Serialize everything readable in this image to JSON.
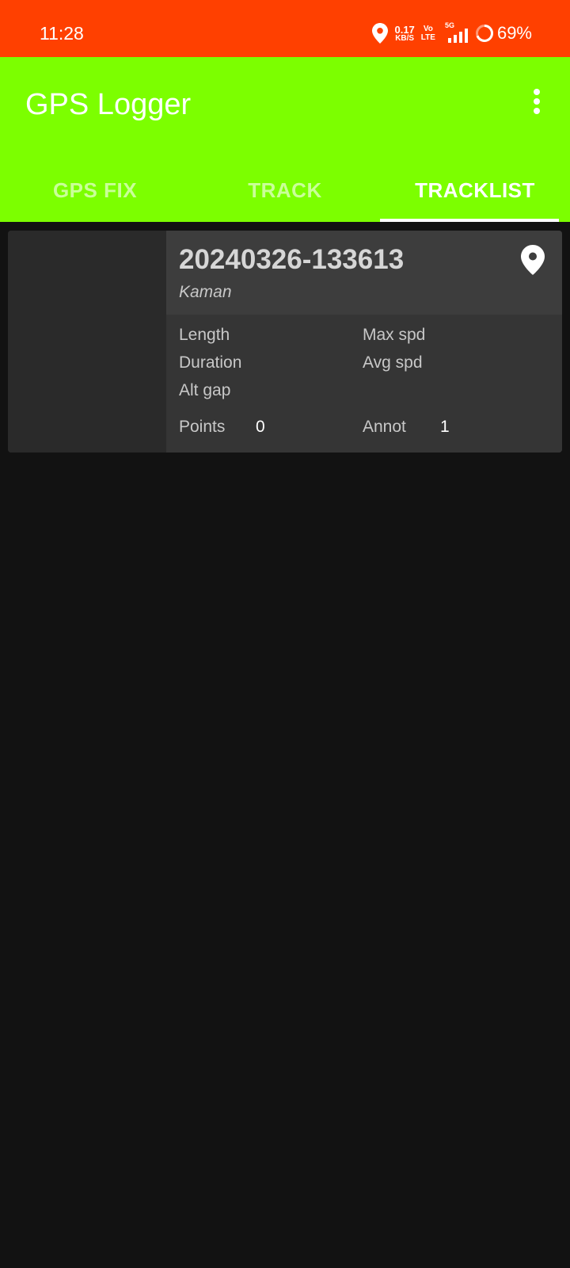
{
  "status_bar": {
    "time": "11:28",
    "net_speed_value": "0.17",
    "net_speed_unit": "KB/S",
    "volte_top": "Vo",
    "volte_bottom": "LTE",
    "network_type": "5G",
    "battery": "69%",
    "battery_level": 0.69,
    "icons": [
      "location-icon",
      "signal-icon",
      "battery-icon"
    ],
    "color": "#ff4000"
  },
  "app_bar": {
    "title": "GPS Logger",
    "color": "#7cff00",
    "menu_icon": "more-vert-icon"
  },
  "tabs": [
    {
      "label": "GPS FIX",
      "active": false
    },
    {
      "label": "TRACK",
      "active": false
    },
    {
      "label": "TRACKLIST",
      "active": true
    }
  ],
  "tracks": [
    {
      "name": "20240326-133613",
      "description": "Kaman",
      "icon": "map-pin-icon",
      "labels": {
        "length": "Length",
        "max_spd": "Max spd",
        "duration": "Duration",
        "avg_spd": "Avg spd",
        "alt_gap": "Alt gap",
        "points": "Points",
        "annot": "Annot"
      },
      "values": {
        "points": "0",
        "annot": "1"
      }
    }
  ]
}
